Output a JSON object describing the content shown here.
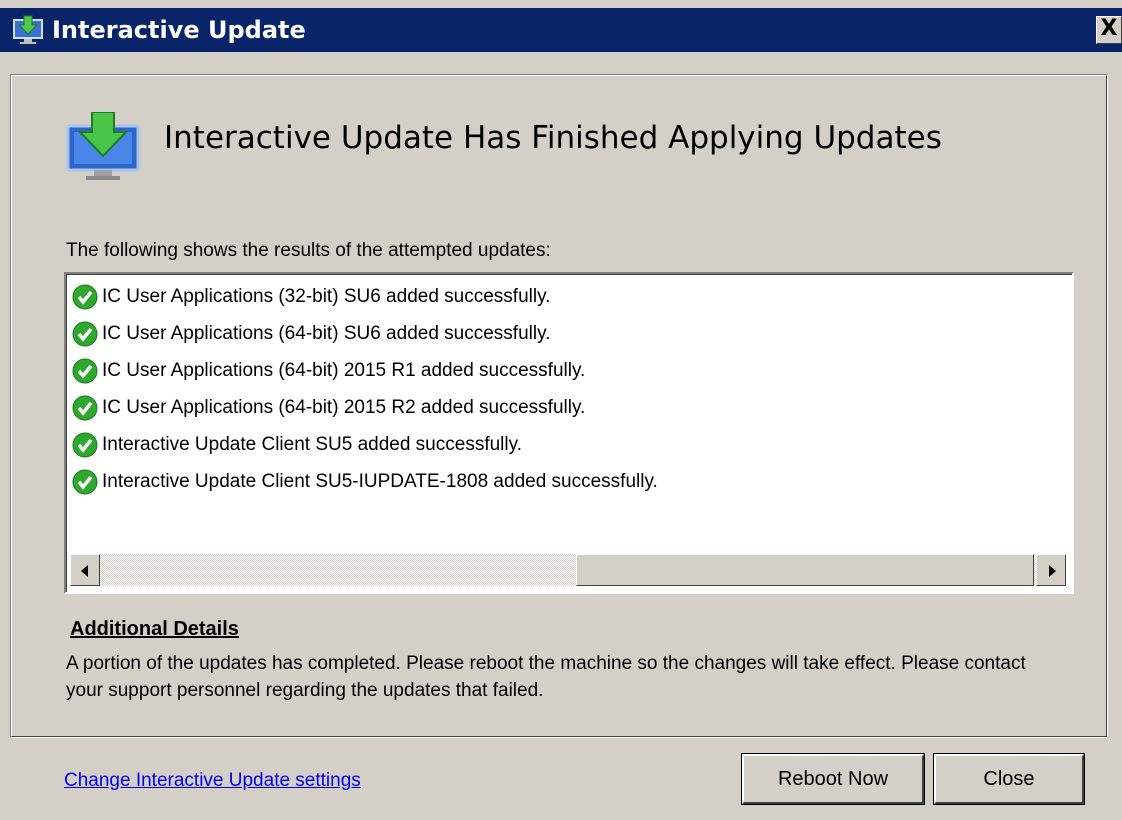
{
  "window": {
    "title": "Interactive Update",
    "close_glyph": "X"
  },
  "header": {
    "title": "Interactive Update Has Finished Applying Updates",
    "icon": "download-monitor-icon"
  },
  "results": {
    "label": "The following shows the results of the attempted updates:",
    "items": [
      {
        "text": "IC User Applications (32-bit) SU6 added successfully.",
        "status": "success"
      },
      {
        "text": "IC User Applications (64-bit) SU6 added successfully.",
        "status": "success"
      },
      {
        "text": "IC User Applications (64-bit) 2015 R1 added successfully.",
        "status": "success"
      },
      {
        "text": "IC User Applications (64-bit) 2015 R2 added successfully.",
        "status": "success"
      },
      {
        "text": "Interactive Update Client SU5 added successfully.",
        "status": "success"
      },
      {
        "text": "Interactive Update Client SU5-IUPDATE-1808 added successfully.",
        "status": "success"
      }
    ],
    "success_icon": "green-checkmark-icon",
    "success_color": "#2fa82f"
  },
  "details": {
    "heading": "Additional Details",
    "text": "A portion of the updates has completed.  Please reboot the machine so the changes will take effect.  Please contact your support personnel regarding the updates that failed."
  },
  "footer": {
    "settings_link": "Change Interactive Update settings",
    "reboot_label": "Reboot Now",
    "close_label": "Close"
  },
  "colors": {
    "titlebar": "#0a246a",
    "face": "#d4d0c8",
    "link": "#0000ee"
  }
}
